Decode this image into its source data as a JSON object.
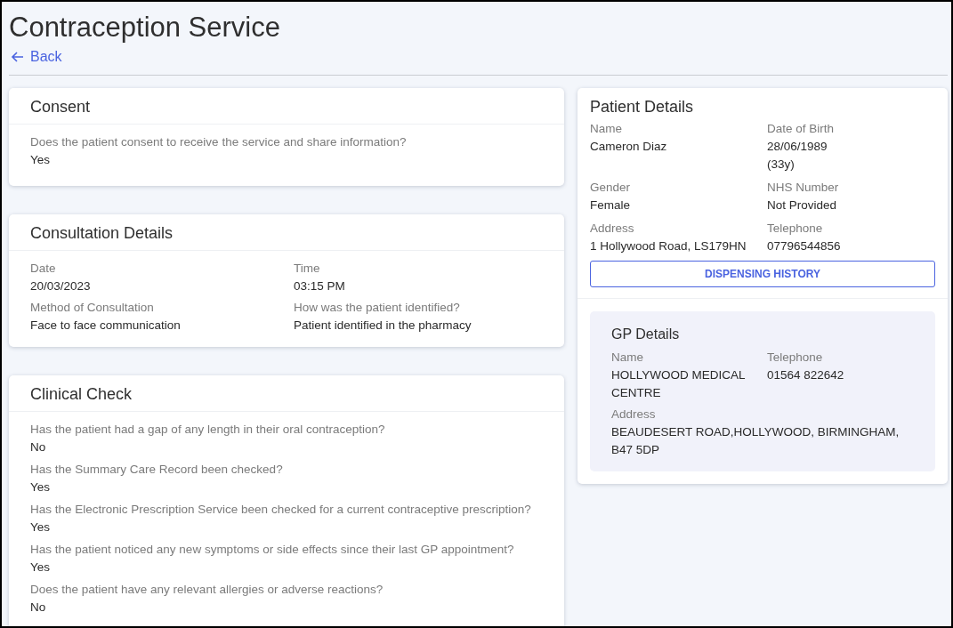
{
  "page": {
    "title": "Contraception Service",
    "back_link": "Back"
  },
  "sections": [
    {
      "title": "Consent",
      "kind": "questions",
      "items": [
        {
          "label": "Does the patient consent to receive the service and share information?",
          "value": "Yes"
        }
      ]
    },
    {
      "title": "Consultation Details",
      "kind": "grid",
      "items": [
        {
          "label": "Date",
          "value": "20/03/2023"
        },
        {
          "label": "Time",
          "value": "03:15 PM"
        },
        {
          "label": "Method of Consultation",
          "value": "Face to face communication"
        },
        {
          "label": "How was the patient identified?",
          "value": "Patient identified in the pharmacy"
        }
      ]
    },
    {
      "title": "Clinical Check",
      "kind": "questions",
      "items": [
        {
          "label": "Has the patient had a gap of any length in their oral contraception?",
          "value": "No"
        },
        {
          "label": "Has the Summary Care Record been checked?",
          "value": "Yes"
        },
        {
          "label": "Has the Electronic Prescription Service been checked for a current contraceptive prescription?",
          "value": "Yes"
        },
        {
          "label": "Has the patient noticed any new symptoms or side effects since their last GP appointment?",
          "value": "Yes"
        },
        {
          "label": "Does the patient have any relevant allergies or adverse reactions?",
          "value": "No"
        }
      ]
    }
  ],
  "patient_details": {
    "title": "Patient Details",
    "fields": [
      {
        "label": "Name",
        "value": "Cameron Diaz"
      },
      {
        "label": "Date of Birth",
        "value": "28/06/1989",
        "note": "(33y)"
      },
      {
        "label": "Gender",
        "value": "Female"
      },
      {
        "label": "NHS Number",
        "value": "Not Provided"
      },
      {
        "label": "Address",
        "value": "1 Hollywood Road, LS179HN"
      },
      {
        "label": "Telephone",
        "value": "07796544856"
      }
    ],
    "button": "DISPENSING HISTORY",
    "gp_details": {
      "title": "GP Details",
      "fields": [
        {
          "label": "Name",
          "value": "HOLLYWOOD MEDICAL CENTRE",
          "kind": "half"
        },
        {
          "label": "Telephone",
          "value": "01564 822642",
          "kind": "half"
        },
        {
          "label": "Address",
          "value": "BEAUDESERT ROAD,HOLLYWOOD, BIRMINGHAM, B47 5DP",
          "kind": "full"
        }
      ]
    }
  }
}
